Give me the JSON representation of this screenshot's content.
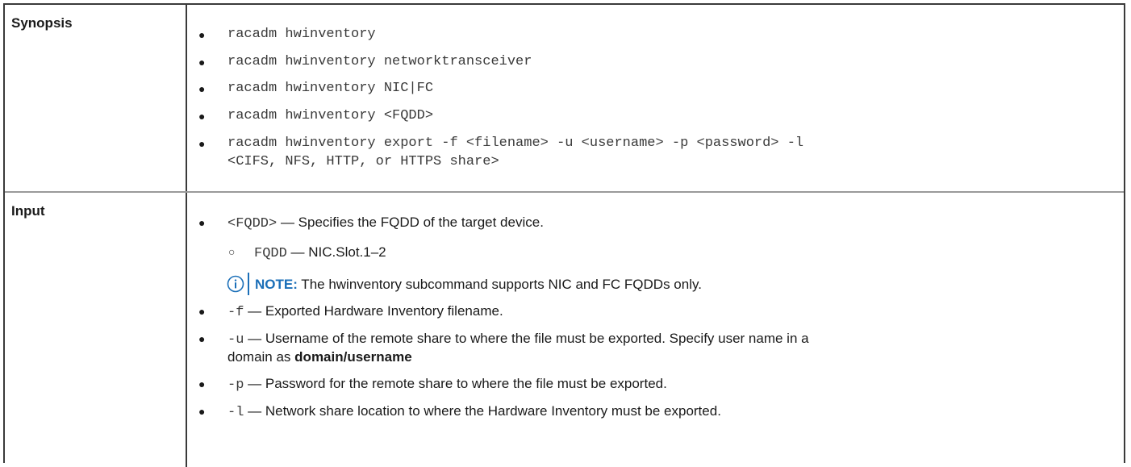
{
  "synopsis": {
    "label": "Synopsis",
    "commands": [
      "racadm hwinventory",
      "racadm hwinventory networktransceiver",
      "racadm hwinventory NIC|FC",
      "racadm hwinventory <FQDD>",
      "racadm hwinventory export -f <filename> -u <username> -p <password> -l"
    ],
    "command_continuation": "<CIFS, NFS, HTTP, or HTTPS share>"
  },
  "input": {
    "label": "Input",
    "fqdd": {
      "code": "<FQDD>",
      "desc": " — Specifies the FQDD of the target device."
    },
    "fqdd_sub": {
      "code": "FQDD",
      "desc": " — NIC.Slot.1–2"
    },
    "note": {
      "label": "NOTE:",
      "text": " The hwinventory subcommand supports NIC and FC FQDDs only."
    },
    "opt_f": {
      "code": "-f",
      "desc": " — Exported Hardware Inventory filename."
    },
    "opt_u": {
      "code": "-u",
      "desc": " — Username of the remote share to where the file must be exported. Specify user name in a",
      "desc_line2": "domain as ",
      "desc_bold": "domain/username"
    },
    "opt_p": {
      "code": "-p",
      "desc": " — Password for the remote share to where the file must be exported."
    },
    "opt_l": {
      "code": "-l",
      "desc": " — Network share location to where the Hardware Inventory must be exported."
    }
  },
  "colors": {
    "note_accent": "#1b6fb8",
    "border": "#3a3a3a",
    "row_divider": "#9a9a9a"
  },
  "icons": {
    "note": "info-circle-icon",
    "bullet": "filled-circle-bullet",
    "sub_bullet": "hollow-circle-bullet"
  }
}
